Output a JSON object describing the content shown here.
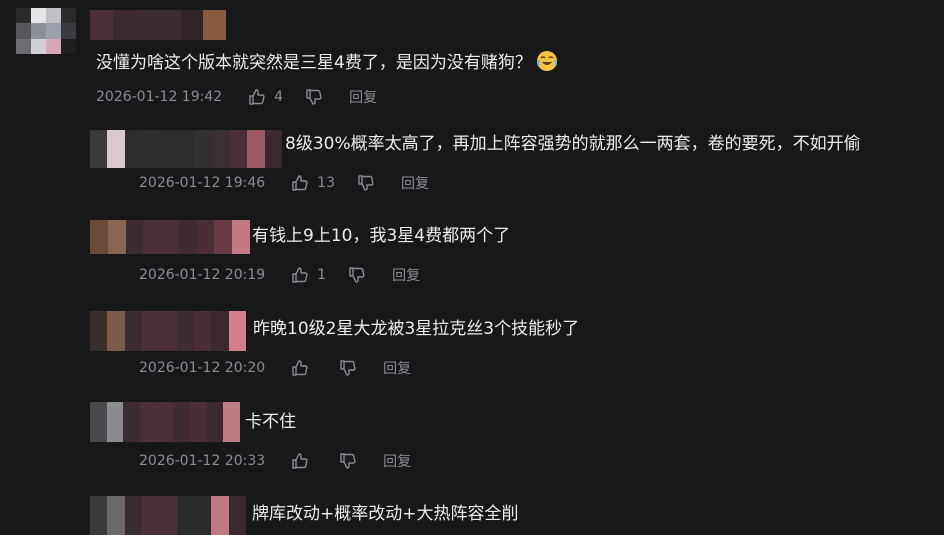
{
  "comments": [
    {
      "text": "没懂为啥这个版本就突然是三星4费了，是因为没有赌狗？",
      "emoji": "laughing-crying-emoji",
      "time": "2026-01-12 19:42",
      "likes": "4",
      "reply": "回复"
    },
    {
      "text": "8级30%概率太高了，再加上阵容强势的就那么一两套，卷的要死，不如开偷",
      "time": "2026-01-12 19:46",
      "likes": "13",
      "reply": "回复"
    },
    {
      "text": "有钱上9上10，我3星4费都两个了",
      "time": "2026-01-12 20:19",
      "likes": "1",
      "reply": "回复"
    },
    {
      "text": "昨晚10级2星大龙被3星拉克丝3个技能秒了",
      "time": "2026-01-12 20:20",
      "likes": "",
      "reply": "回复"
    },
    {
      "text": "卡不住",
      "time": "2026-01-12 20:33",
      "likes": "",
      "reply": "回复"
    },
    {
      "text": "牌库改动+概率改动+大热阵容全削"
    }
  ]
}
